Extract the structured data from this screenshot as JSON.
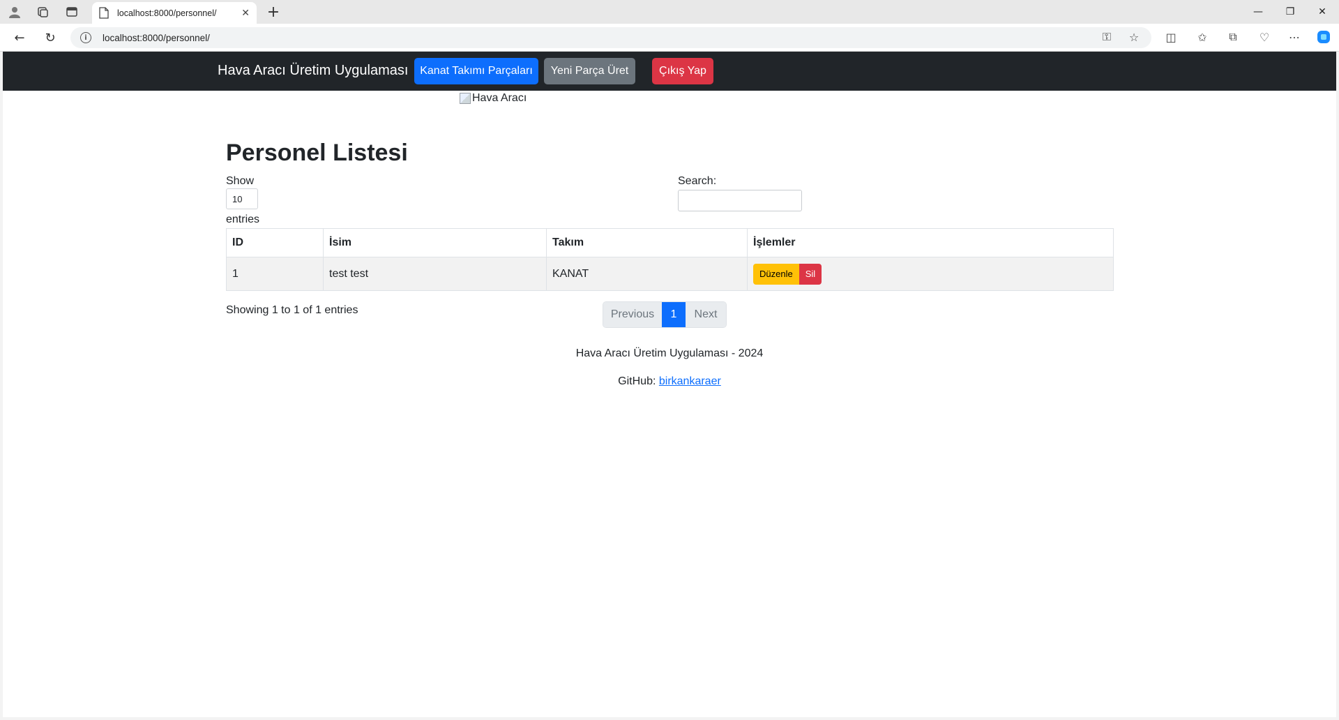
{
  "browser": {
    "tab_title": "localhost:8000/personnel/",
    "url": "localhost:8000/personnel/"
  },
  "navbar": {
    "brand": "Hava Aracı Üretim Uygulaması",
    "btn_parts": "Kanat Takımı Parçaları",
    "btn_new_part": "Yeni Parça Üret",
    "btn_logout": "Çıkış Yap"
  },
  "hero_image_alt": "Hava Aracı",
  "page": {
    "title": "Personel Listesi",
    "show_label": "Show",
    "show_value": "10",
    "entries_label": "entries",
    "search_label": "Search:",
    "search_value": ""
  },
  "table": {
    "headers": [
      "ID",
      "İsim",
      "Takım",
      "İşlemler"
    ],
    "rows": [
      {
        "id": "1",
        "name": "test test",
        "team": "KANAT",
        "edit_label": "Düzenle",
        "delete_label": "Sil"
      }
    ]
  },
  "info": "Showing 1 to 1 of 1 entries",
  "pagination": {
    "previous": "Previous",
    "current": "1",
    "next": "Next"
  },
  "footer": {
    "line1": "Hava Aracı Üretim Uygulaması - 2024",
    "github_label": "GitHub:",
    "github_link": "birkankaraer"
  },
  "colors": {
    "navbar_bg": "#212529",
    "primary": "#0d6efd",
    "secondary": "#6c757d",
    "danger": "#dc3545",
    "warning": "#ffc107"
  }
}
